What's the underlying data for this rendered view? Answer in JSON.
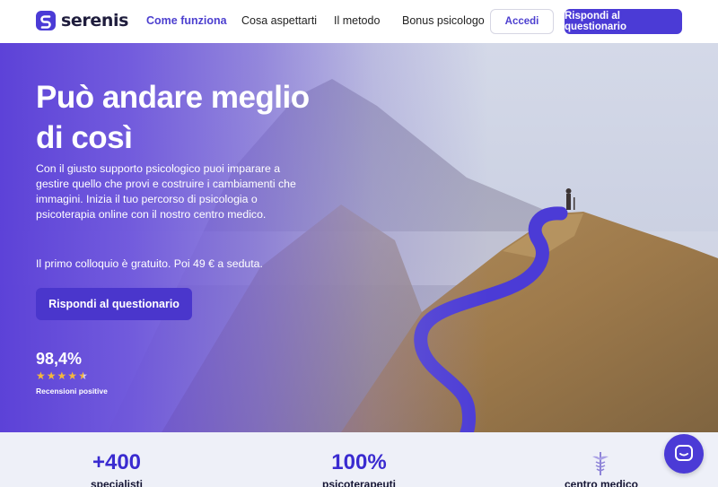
{
  "brand": {
    "name": "serenis"
  },
  "nav": {
    "items": [
      "Come funziona",
      "Cosa aspettarti",
      "Il metodo",
      "Bonus psicologo"
    ],
    "login_label": "Accedi",
    "cta_label": "Rispondi al questionario"
  },
  "hero": {
    "title_line1": "Può andare meglio",
    "title_line2": "di così",
    "description": "Con il giusto supporto psicologico puoi imparare a gestire quello che provi e costruire i cambiamenti che immagini. Inizia il tuo percorso di psicologia o psicoterapia online con il nostro centro medico.",
    "price_note": "Il primo colloquio è gratuito. Poi 49 € a seduta.",
    "cta_label": "Rispondi al questionario",
    "rating_value": "98,4%",
    "rating_stars": 4.5,
    "rating_label": "Recensioni positive"
  },
  "stats": [
    {
      "value": "+400",
      "label": "specialisti"
    },
    {
      "value": "100%",
      "label": "psicoterapeuti"
    },
    {
      "value": "",
      "label": "centro medico"
    }
  ],
  "colors": {
    "primary": "#4b3bd6",
    "accent_text": "#3a2bd0",
    "star": "#f5b83c",
    "stats_bg": "#eef0f8"
  },
  "icons": [
    "serenis-logo-icon",
    "caduceus-icon",
    "chat-icon",
    "star-icon"
  ]
}
